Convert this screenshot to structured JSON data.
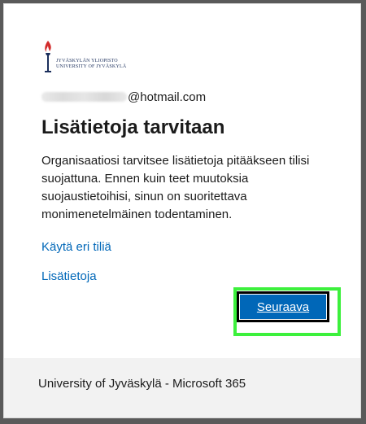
{
  "organization": {
    "logo_line1": "JYVÄSKYLÄN YLIOPISTO",
    "logo_line2": "UNIVERSITY OF JYVÄSKYLÄ",
    "logo_icon": "torch-icon"
  },
  "account": {
    "username_redacted": true,
    "domain": "@hotmail.com"
  },
  "title": "Lisätietoja tarvitaan",
  "description": "Organisaatiosi tarvitsee lisätietoja pitääkseen tilisi suojattuna. Ennen kuin teet muutoksia suojaustietoihisi, sinun on suoritettava monimenetelmäinen todentaminen.",
  "links": {
    "use_other_account": "Käytä eri tiliä",
    "more_info": "Lisätietoja"
  },
  "actions": {
    "next_label": "Seuraava"
  },
  "footer": {
    "text": "University of Jyväskylä - Microsoft 365"
  },
  "colors": {
    "accent": "#0067b8",
    "highlight": "#3cf03c",
    "footer_bg": "#f2f2f2"
  }
}
